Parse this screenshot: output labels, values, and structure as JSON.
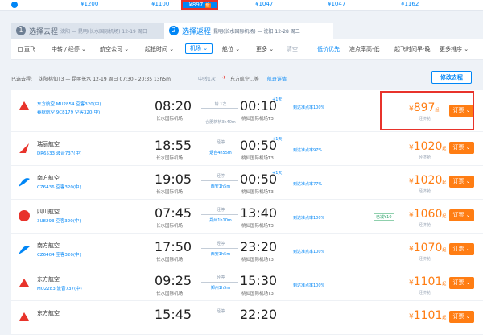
{
  "date_prices": [
    "¥1200",
    "¥1100",
    "¥897",
    "¥1047",
    "¥1047",
    "¥1162"
  ],
  "selected_badge": "低",
  "tabs": [
    {
      "num": "1",
      "label": "选择去程",
      "sub": "沈阳 — 昆明(长水国际机场) 12-19 周日"
    },
    {
      "num": "2",
      "label": "选择返程",
      "sub": "昆明(长水国际机场) — 沈阳 12-28 周二"
    }
  ],
  "filters": {
    "direct": "直飞",
    "stop": "中转 / 经停",
    "airline": "航空公司",
    "dep_time": "起抵时间",
    "airport": "机场",
    "cabin": "舱位",
    "more": "更多",
    "clear": "清空",
    "sort_low": "低价优先",
    "sort_dep": "准点率高-低",
    "sort_time": "起飞时间早-晚",
    "sort_more": "更多排序"
  },
  "outbound": {
    "prefix": "已选去程:",
    "route": "沈阳桃仙T3 — 昆明长水 12-19 周日 07:30 - 20:35 13h5m",
    "stop": "中转1次",
    "airline": "东方航空...等",
    "detail": "航班详情",
    "change": "修改去程"
  },
  "flights": [
    {
      "airline": "东方航空 MU2854 空客320(中)",
      "code": "春秋航空 9C8179 空客320(中)",
      "dep": "08:20",
      "dep_ap": "长水国际机场",
      "mid_top": "转 1次",
      "mid_bot": "合肥新桥3h40m",
      "arr": "00:10",
      "plus": "+1天",
      "arr_ap": "桃仙国际机场T3",
      "ontime": "到达准点率100%",
      "price": "897",
      "note": "经济舱",
      "book": "订票",
      "tag": "",
      "ref": "1小时1分钟中转"
    },
    {
      "airline": "瑞丽航空",
      "code": "DR6533 波音737(中)",
      "dep": "18:55",
      "dep_ap": "长水国际机场",
      "mid_top": "经停",
      "mid_bot": "烟台4h55m",
      "arr": "00:50",
      "plus": "+1天",
      "arr_ap": "桃仙国际机场T3",
      "ontime": "到达准点率97%",
      "price": "1020",
      "note": "经济舱",
      "book": "订票",
      "tag": "",
      "ref": ""
    },
    {
      "airline": "南方航空",
      "code": "CZ6436 空客320(中)",
      "dep": "19:05",
      "dep_ap": "长水国际机场",
      "mid_top": "经停",
      "mid_bot": "西安1h5m",
      "arr": "00:50",
      "plus": "+1天",
      "arr_ap": "桃仙国际机场T3",
      "ontime": "到达准点率77%",
      "price": "1020",
      "note": "经济舱",
      "book": "订票",
      "tag": "",
      "ref": ""
    },
    {
      "airline": "四川航空",
      "code": "3U8293 空客320(中)",
      "dep": "07:45",
      "dep_ap": "长水国际机场",
      "mid_top": "经停",
      "mid_bot": "郑州1h10m",
      "arr": "13:40",
      "plus": "",
      "arr_ap": "桃仙国际机场T3",
      "ontime": "到达准点率100%",
      "price": "1060",
      "note": "经济舱",
      "book": "订票",
      "tag": "已减¥10",
      "ref": ""
    },
    {
      "airline": "南方航空",
      "code": "CZ6404 空客320(中)",
      "dep": "17:50",
      "dep_ap": "长水国际机场",
      "mid_top": "经停",
      "mid_bot": "西安1h5m",
      "arr": "23:20",
      "plus": "",
      "arr_ap": "桃仙国际机场T3",
      "ontime": "到达准点率100%",
      "price": "1070",
      "note": "经济舱",
      "book": "订票",
      "tag": "",
      "ref": ""
    },
    {
      "airline": "东方航空",
      "code": "MU2283 波音737(中)",
      "dep": "09:25",
      "dep_ap": "长水国际机场",
      "mid_top": "经停",
      "mid_bot": "郑州1h5m",
      "arr": "15:30",
      "plus": "",
      "arr_ap": "桃仙国际机场T3",
      "ontime": "到达准点率100%",
      "price": "1101",
      "note": "经济舱",
      "book": "订票",
      "tag": "",
      "ref": ""
    },
    {
      "airline": "东方航空",
      "code": "",
      "dep": "15:45",
      "dep_ap": "",
      "mid_top": "经停",
      "mid_bot": "",
      "arr": "22:20",
      "plus": "",
      "arr_ap": "",
      "ontime": "",
      "price": "1101",
      "note": "",
      "book": "订票",
      "tag": "",
      "ref": ""
    }
  ],
  "colors": {
    "accent": "#0086f6",
    "price": "#ff7d13",
    "highlight": "#e8332b"
  }
}
